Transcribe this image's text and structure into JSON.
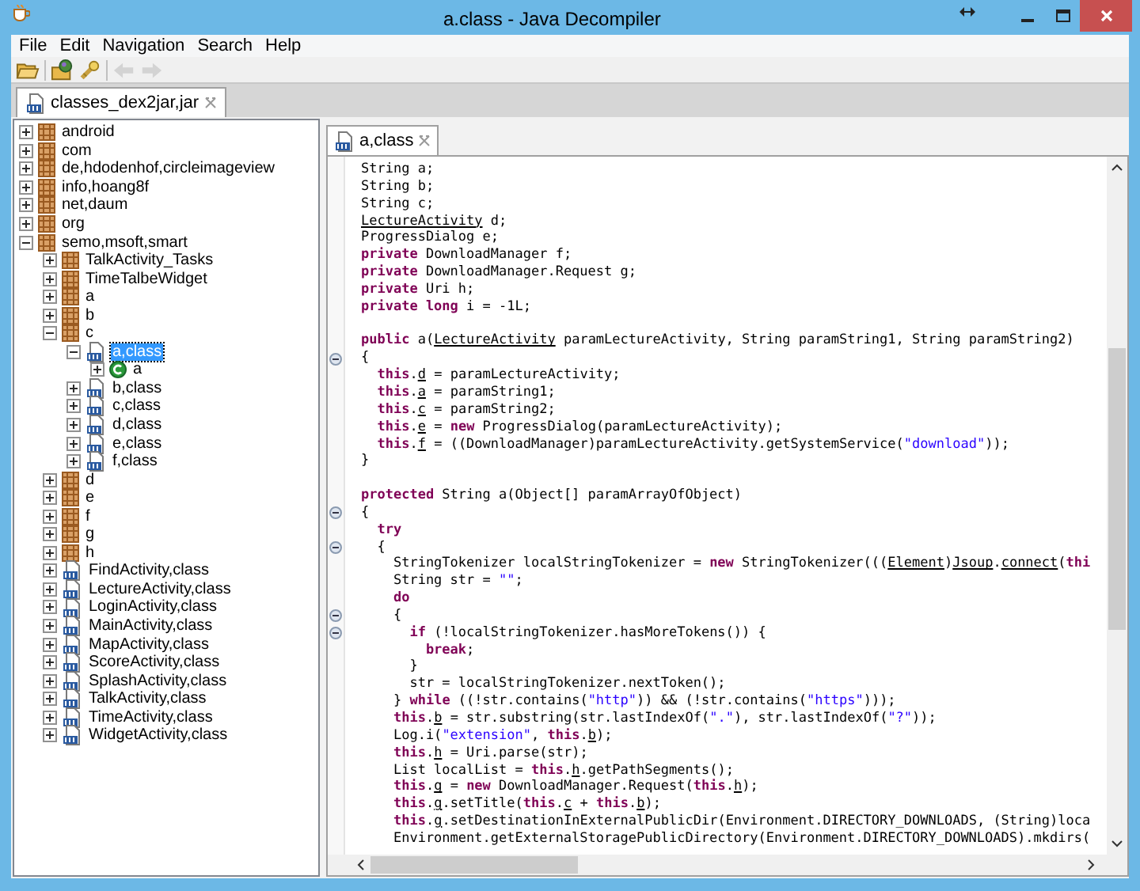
{
  "window": {
    "title": "a.class - Java Decompiler"
  },
  "menu": [
    "File",
    "Edit",
    "Navigation",
    "Search",
    "Help"
  ],
  "toolbar": [
    {
      "kind": "open",
      "disabled": false
    },
    {
      "kind": "open-type",
      "disabled": false
    },
    {
      "kind": "search",
      "disabled": false
    },
    {
      "kind": "back",
      "disabled": true
    },
    {
      "kind": "forward",
      "disabled": true
    }
  ],
  "file_tab": {
    "label": "classes_dex2jar,jar",
    "selected": true
  },
  "tree": [
    {
      "label": "android",
      "kind": "package",
      "expanded": false,
      "selected": false
    },
    {
      "label": "com",
      "kind": "package",
      "expanded": false,
      "selected": false
    },
    {
      "label": "de,hdodenhof,circleimageview",
      "kind": "package",
      "expanded": false,
      "selected": false
    },
    {
      "label": "info,hoang8f",
      "kind": "package",
      "expanded": false,
      "selected": false
    },
    {
      "label": "net,daum",
      "kind": "package",
      "expanded": false,
      "selected": false
    },
    {
      "label": "org",
      "kind": "package",
      "expanded": false,
      "selected": false
    },
    {
      "label": "semo,msoft,smart",
      "kind": "package",
      "expanded": true,
      "selected": false,
      "children": [
        {
          "label": "TalkActivity_Tasks",
          "kind": "package",
          "expanded": false,
          "selected": false
        },
        {
          "label": "TimeTalbeWidget",
          "kind": "package",
          "expanded": false,
          "selected": false
        },
        {
          "label": "a",
          "kind": "package",
          "expanded": false,
          "selected": false
        },
        {
          "label": "b",
          "kind": "package",
          "expanded": false,
          "selected": false
        },
        {
          "label": "c",
          "kind": "package",
          "expanded": true,
          "selected": false,
          "children": [
            {
              "label": "a,class",
              "kind": "classfile",
              "expanded": true,
              "selected": true,
              "children": [
                {
                  "label": "a",
                  "kind": "class",
                  "expanded": false,
                  "selected": false
                }
              ]
            },
            {
              "label": "b,class",
              "kind": "classfile",
              "expanded": false,
              "selected": false
            },
            {
              "label": "c,class",
              "kind": "classfile",
              "expanded": false,
              "selected": false
            },
            {
              "label": "d,class",
              "kind": "classfile",
              "expanded": false,
              "selected": false
            },
            {
              "label": "e,class",
              "kind": "classfile",
              "expanded": false,
              "selected": false
            },
            {
              "label": "f,class",
              "kind": "classfile",
              "expanded": false,
              "selected": false
            }
          ]
        },
        {
          "label": "d",
          "kind": "package",
          "expanded": false,
          "selected": false
        },
        {
          "label": "e",
          "kind": "package",
          "expanded": false,
          "selected": false
        },
        {
          "label": "f",
          "kind": "package",
          "expanded": false,
          "selected": false
        },
        {
          "label": "g",
          "kind": "package",
          "expanded": false,
          "selected": false
        },
        {
          "label": "h",
          "kind": "package",
          "expanded": false,
          "selected": false
        },
        {
          "label": "FindActivity,class",
          "kind": "classfile",
          "expanded": false,
          "selected": false
        },
        {
          "label": "LectureActivity,class",
          "kind": "classfile",
          "expanded": false,
          "selected": false
        },
        {
          "label": "LoginActivity,class",
          "kind": "classfile",
          "expanded": false,
          "selected": false
        },
        {
          "label": "MainActivity,class",
          "kind": "classfile",
          "expanded": false,
          "selected": false
        },
        {
          "label": "MapActivity,class",
          "kind": "classfile",
          "expanded": false,
          "selected": false
        },
        {
          "label": "ScoreActivity,class",
          "kind": "classfile",
          "expanded": false,
          "selected": false
        },
        {
          "label": "SplashActivity,class",
          "kind": "classfile",
          "expanded": false,
          "selected": false
        },
        {
          "label": "TalkActivity,class",
          "kind": "classfile",
          "expanded": false,
          "selected": false
        },
        {
          "label": "TimeActivity,class",
          "kind": "classfile",
          "expanded": false,
          "selected": false
        },
        {
          "label": "WidgetActivity,class",
          "kind": "classfile",
          "expanded": false,
          "selected": false
        }
      ]
    }
  ],
  "editor_tab": {
    "label": "a,class",
    "selected": true
  },
  "code": [
    {
      "fold": false,
      "segments": [
        {
          "kind": "plain",
          "text": "String a;"
        }
      ]
    },
    {
      "fold": false,
      "segments": [
        {
          "kind": "plain",
          "text": "String b;"
        }
      ]
    },
    {
      "fold": false,
      "segments": [
        {
          "kind": "plain",
          "text": "String c;"
        }
      ]
    },
    {
      "fold": false,
      "segments": [
        {
          "kind": "ref",
          "text": "LectureActivity"
        },
        {
          "kind": "plain",
          "text": " d;"
        }
      ]
    },
    {
      "fold": false,
      "segments": [
        {
          "kind": "plain",
          "text": "ProgressDialog e;"
        }
      ]
    },
    {
      "fold": false,
      "segments": [
        {
          "kind": "keyword",
          "text": "private"
        },
        {
          "kind": "plain",
          "text": " DownloadManager f;"
        }
      ]
    },
    {
      "fold": false,
      "segments": [
        {
          "kind": "keyword",
          "text": "private"
        },
        {
          "kind": "plain",
          "text": " DownloadManager.Request g;"
        }
      ]
    },
    {
      "fold": false,
      "segments": [
        {
          "kind": "keyword",
          "text": "private"
        },
        {
          "kind": "plain",
          "text": " Uri h;"
        }
      ]
    },
    {
      "fold": false,
      "segments": [
        {
          "kind": "keyword",
          "text": "private long"
        },
        {
          "kind": "plain",
          "text": " i = -1L;"
        }
      ]
    },
    {
      "fold": false,
      "blank_line_before": true,
      "segments": [
        {
          "kind": "keyword",
          "text": "public"
        },
        {
          "kind": "plain",
          "text": " a("
        },
        {
          "kind": "ref",
          "text": "LectureActivity"
        },
        {
          "kind": "plain",
          "text": " paramLectureActivity, String paramString1, String paramString2)"
        }
      ]
    },
    {
      "fold": true,
      "segments": [
        {
          "kind": "plain",
          "text": "{"
        }
      ]
    },
    {
      "fold": false,
      "segments": [
        {
          "kind": "keyword",
          "text": "  this"
        },
        {
          "kind": "plain",
          "text": "."
        },
        {
          "kind": "ref",
          "text": "d"
        },
        {
          "kind": "plain",
          "text": " = paramLectureActivity;"
        }
      ]
    },
    {
      "fold": false,
      "segments": [
        {
          "kind": "keyword",
          "text": "  this"
        },
        {
          "kind": "plain",
          "text": "."
        },
        {
          "kind": "ref",
          "text": "a"
        },
        {
          "kind": "plain",
          "text": " = paramString1;"
        }
      ]
    },
    {
      "fold": false,
      "segments": [
        {
          "kind": "keyword",
          "text": "  this"
        },
        {
          "kind": "plain",
          "text": "."
        },
        {
          "kind": "ref",
          "text": "c"
        },
        {
          "kind": "plain",
          "text": " = paramString2;"
        }
      ]
    },
    {
      "fold": false,
      "segments": [
        {
          "kind": "keyword",
          "text": "  this"
        },
        {
          "kind": "plain",
          "text": "."
        },
        {
          "kind": "ref",
          "text": "e"
        },
        {
          "kind": "plain",
          "text": " = "
        },
        {
          "kind": "keyword",
          "text": "new"
        },
        {
          "kind": "plain",
          "text": " ProgressDialog(paramLectureActivity);"
        }
      ]
    },
    {
      "fold": false,
      "segments": [
        {
          "kind": "keyword",
          "text": "  this"
        },
        {
          "kind": "plain",
          "text": "."
        },
        {
          "kind": "ref",
          "text": "f"
        },
        {
          "kind": "plain",
          "text": " = ((DownloadManager)paramLectureActivity.getSystemService("
        },
        {
          "kind": "string",
          "text": "\"download\""
        },
        {
          "kind": "plain",
          "text": "));"
        }
      ]
    },
    {
      "fold": false,
      "segments": [
        {
          "kind": "plain",
          "text": "}"
        }
      ]
    },
    {
      "fold": false,
      "blank_line_before": true,
      "segments": [
        {
          "kind": "keyword",
          "text": "protected"
        },
        {
          "kind": "plain",
          "text": " String a(Object[] paramArrayOfObject)"
        }
      ]
    },
    {
      "fold": true,
      "segments": [
        {
          "kind": "plain",
          "text": "{"
        }
      ]
    },
    {
      "fold": false,
      "segments": [
        {
          "kind": "keyword",
          "text": "  try"
        }
      ]
    },
    {
      "fold": true,
      "segments": [
        {
          "kind": "plain",
          "text": "  {"
        }
      ]
    },
    {
      "fold": false,
      "segments": [
        {
          "kind": "plain",
          "text": "    StringTokenizer localStringTokenizer = "
        },
        {
          "kind": "keyword",
          "text": "new"
        },
        {
          "kind": "plain",
          "text": " StringTokenizer((("
        },
        {
          "kind": "ref",
          "text": "Element"
        },
        {
          "kind": "plain",
          "text": ")"
        },
        {
          "kind": "ref",
          "text": "Jsoup"
        },
        {
          "kind": "plain",
          "text": "."
        },
        {
          "kind": "ref",
          "text": "connect"
        },
        {
          "kind": "plain",
          "text": "("
        },
        {
          "kind": "keyword",
          "text": "thi"
        }
      ]
    },
    {
      "fold": false,
      "segments": [
        {
          "kind": "plain",
          "text": "    String str = "
        },
        {
          "kind": "string",
          "text": "\"\""
        },
        {
          "kind": "plain",
          "text": ";"
        }
      ]
    },
    {
      "fold": false,
      "segments": [
        {
          "kind": "keyword",
          "text": "    do"
        }
      ]
    },
    {
      "fold": true,
      "segments": [
        {
          "kind": "plain",
          "text": "    {"
        }
      ]
    },
    {
      "fold": true,
      "segments": [
        {
          "kind": "keyword",
          "text": "      if"
        },
        {
          "kind": "plain",
          "text": " (!localStringTokenizer.hasMoreTokens()) {"
        }
      ]
    },
    {
      "fold": false,
      "segments": [
        {
          "kind": "keyword",
          "text": "        break"
        },
        {
          "kind": "plain",
          "text": ";"
        }
      ]
    },
    {
      "fold": false,
      "segments": [
        {
          "kind": "plain",
          "text": "      }"
        }
      ]
    },
    {
      "fold": false,
      "segments": [
        {
          "kind": "plain",
          "text": "      str = localStringTokenizer.nextToken();"
        }
      ]
    },
    {
      "fold": false,
      "segments": [
        {
          "kind": "plain",
          "text": "    } "
        },
        {
          "kind": "keyword",
          "text": "while"
        },
        {
          "kind": "plain",
          "text": " ((!str.contains("
        },
        {
          "kind": "string",
          "text": "\"http\""
        },
        {
          "kind": "plain",
          "text": ")) && (!str.contains("
        },
        {
          "kind": "string",
          "text": "\"https\""
        },
        {
          "kind": "plain",
          "text": ")));"
        }
      ]
    },
    {
      "fold": false,
      "segments": [
        {
          "kind": "keyword",
          "text": "    this"
        },
        {
          "kind": "plain",
          "text": "."
        },
        {
          "kind": "ref",
          "text": "b"
        },
        {
          "kind": "plain",
          "text": " = str.substring(str.lastIndexOf("
        },
        {
          "kind": "string",
          "text": "\".\""
        },
        {
          "kind": "plain",
          "text": "), str.lastIndexOf("
        },
        {
          "kind": "string",
          "text": "\"?\""
        },
        {
          "kind": "plain",
          "text": "));"
        }
      ]
    },
    {
      "fold": false,
      "segments": [
        {
          "kind": "plain",
          "text": "    Log.i("
        },
        {
          "kind": "string",
          "text": "\"extension\""
        },
        {
          "kind": "plain",
          "text": ", "
        },
        {
          "kind": "keyword",
          "text": "this"
        },
        {
          "kind": "plain",
          "text": "."
        },
        {
          "kind": "ref",
          "text": "b"
        },
        {
          "kind": "plain",
          "text": ");"
        }
      ]
    },
    {
      "fold": false,
      "segments": [
        {
          "kind": "keyword",
          "text": "    this"
        },
        {
          "kind": "plain",
          "text": "."
        },
        {
          "kind": "ref",
          "text": "h"
        },
        {
          "kind": "plain",
          "text": " = Uri.parse(str);"
        }
      ]
    },
    {
      "fold": false,
      "segments": [
        {
          "kind": "plain",
          "text": "    List localList = "
        },
        {
          "kind": "keyword",
          "text": "this"
        },
        {
          "kind": "plain",
          "text": "."
        },
        {
          "kind": "ref",
          "text": "h"
        },
        {
          "kind": "plain",
          "text": ".getPathSegments();"
        }
      ]
    },
    {
      "fold": false,
      "segments": [
        {
          "kind": "keyword",
          "text": "    this"
        },
        {
          "kind": "plain",
          "text": "."
        },
        {
          "kind": "ref",
          "text": "g"
        },
        {
          "kind": "plain",
          "text": " = "
        },
        {
          "kind": "keyword",
          "text": "new"
        },
        {
          "kind": "plain",
          "text": " DownloadManager.Request("
        },
        {
          "kind": "keyword",
          "text": "this"
        },
        {
          "kind": "plain",
          "text": "."
        },
        {
          "kind": "ref",
          "text": "h"
        },
        {
          "kind": "plain",
          "text": ");"
        }
      ]
    },
    {
      "fold": false,
      "segments": [
        {
          "kind": "keyword",
          "text": "    this"
        },
        {
          "kind": "plain",
          "text": "."
        },
        {
          "kind": "ref",
          "text": "g"
        },
        {
          "kind": "plain",
          "text": ".setTitle("
        },
        {
          "kind": "keyword",
          "text": "this"
        },
        {
          "kind": "plain",
          "text": "."
        },
        {
          "kind": "ref",
          "text": "c"
        },
        {
          "kind": "plain",
          "text": " + "
        },
        {
          "kind": "keyword",
          "text": "this"
        },
        {
          "kind": "plain",
          "text": "."
        },
        {
          "kind": "ref",
          "text": "b"
        },
        {
          "kind": "plain",
          "text": ");"
        }
      ]
    },
    {
      "fold": false,
      "segments": [
        {
          "kind": "keyword",
          "text": "    this"
        },
        {
          "kind": "plain",
          "text": "."
        },
        {
          "kind": "ref",
          "text": "g"
        },
        {
          "kind": "plain",
          "text": ".setDestinationInExternalPublicDir(Environment.DIRECTORY_DOWNLOADS, (String)loca"
        }
      ]
    },
    {
      "fold": false,
      "segments": [
        {
          "kind": "plain",
          "text": "    Environment.getExternalStoragePublicDirectory(Environment.DIRECTORY_DOWNLOADS).mkdirs("
        }
      ]
    }
  ]
}
